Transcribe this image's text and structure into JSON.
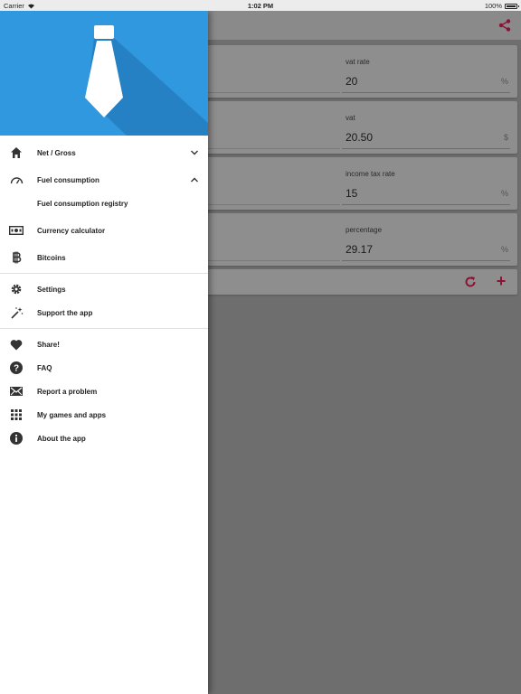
{
  "status_bar": {
    "carrier": "Carrier",
    "time": "1:02 PM",
    "battery": "100%"
  },
  "colors": {
    "accent": "#d81b60",
    "header_blue": "#2f98de",
    "icon_dark": "#333333"
  },
  "drawer": {
    "sections": [
      [
        {
          "icon": "home-icon",
          "label": "Net / Gross",
          "chevron": "down"
        },
        {
          "icon": "speedometer-icon",
          "label": "Fuel consumption",
          "chevron": "up"
        },
        {
          "icon": "",
          "label": "Fuel consumption registry",
          "sub": true
        },
        {
          "icon": "banknote-icon",
          "label": "Currency calculator"
        },
        {
          "icon": "bitcoin-icon",
          "label": "Bitcoins"
        }
      ],
      [
        {
          "icon": "gear-icon",
          "label": "Settings"
        },
        {
          "icon": "magic-wand-icon",
          "label": "Support the app"
        }
      ],
      [
        {
          "icon": "heart-icon",
          "label": "Share!"
        },
        {
          "icon": "question-icon",
          "label": "FAQ"
        },
        {
          "icon": "envelope-icon",
          "label": "Report a problem"
        },
        {
          "icon": "grid-icon",
          "label": "My games and apps"
        },
        {
          "icon": "info-icon",
          "label": "About the app"
        }
      ]
    ]
  },
  "cards": [
    {
      "label": "vat rate",
      "value": "20",
      "unit": "%"
    },
    {
      "label": "vat",
      "value": "20.50",
      "unit": "$"
    },
    {
      "label": "income tax rate",
      "value": "15",
      "unit": "%"
    },
    {
      "label": "percentage",
      "value": "29.17",
      "unit": "%"
    }
  ],
  "actions": {
    "refresh_icon": "refresh-icon",
    "add_label": "+"
  }
}
